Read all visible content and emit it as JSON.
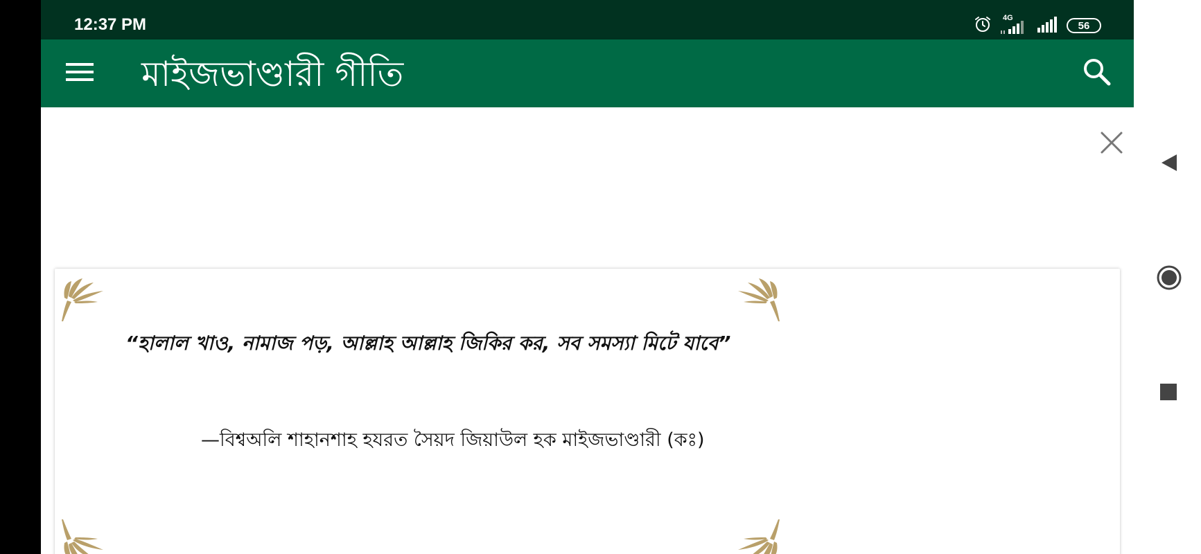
{
  "status_bar": {
    "time": "12:37 PM",
    "network_label": "4G",
    "battery_level": "56",
    "icons": [
      "alarm-icon",
      "signal-4g-icon",
      "signal-icon",
      "battery-icon"
    ]
  },
  "app_bar": {
    "title": "মাইজভাণ্ডারী গীতি",
    "menu_icon": "hamburger-menu-icon",
    "search_icon": "search-icon",
    "background_color": "#006a45",
    "status_color": "#013220"
  },
  "ad_banner": {
    "close_icon": "close-icon"
  },
  "quote_card": {
    "quote": "“হালাল খাও, নামাজ পড়, আল্লাহ আল্লাহ জিকির কর, সব সমস্যা মিটে যাবে”",
    "author": "—বিশ্বঅলি শাহানশাহ হযরত সৈয়দ জিয়াউল হক মাইজভাণ্ডারী (কঃ)",
    "ornament_color": "#b9a06a"
  },
  "system_nav": {
    "back_icon": "back-triangle-icon",
    "home_icon": "home-circle-icon",
    "recents_icon": "recents-square-icon"
  }
}
